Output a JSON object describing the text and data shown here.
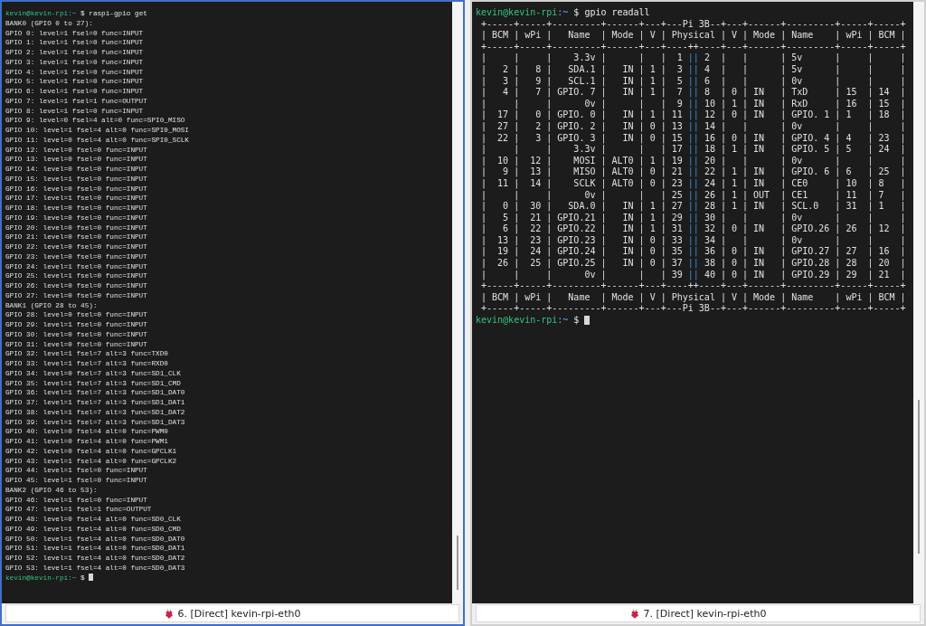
{
  "panes": [
    {
      "focused": true,
      "tab_label": "6. [Direct] kevin-rpi-eth0",
      "lines": [
        {
          "kind": "prompt",
          "user_host": "kevin@kevin-rpi",
          "path": ":~",
          "symbol": "$",
          "command": "raspi-gpio get"
        },
        {
          "kind": "output",
          "text": "BANK0 (GPIO 0 to 27):"
        },
        {
          "kind": "output",
          "text": "GPIO 0: level=1 fsel=0 func=INPUT"
        },
        {
          "kind": "output",
          "text": "GPIO 1: level=1 fsel=0 func=INPUT"
        },
        {
          "kind": "output",
          "text": "GPIO 2: level=1 fsel=0 func=INPUT"
        },
        {
          "kind": "output",
          "text": "GPIO 3: level=1 fsel=0 func=INPUT"
        },
        {
          "kind": "output",
          "text": "GPIO 4: level=1 fsel=0 func=INPUT"
        },
        {
          "kind": "output",
          "text": "GPIO 5: level=1 fsel=0 func=INPUT"
        },
        {
          "kind": "output",
          "text": "GPIO 6: level=1 fsel=0 func=INPUT"
        },
        {
          "kind": "output",
          "text": "GPIO 7: level=1 fsel=1 func=OUTPUT"
        },
        {
          "kind": "output",
          "text": "GPIO 8: level=1 fsel=0 func=INPUT"
        },
        {
          "kind": "output",
          "text": "GPIO 9: level=0 fsel=4 alt=0 func=SPI0_MISO"
        },
        {
          "kind": "output",
          "text": "GPIO 10: level=1 fsel=4 alt=0 func=SPI0_MOSI"
        },
        {
          "kind": "output",
          "text": "GPIO 11: level=0 fsel=4 alt=0 func=SPI0_SCLK"
        },
        {
          "kind": "output",
          "text": "GPIO 12: level=0 fsel=0 func=INPUT"
        },
        {
          "kind": "output",
          "text": "GPIO 13: level=0 fsel=0 func=INPUT"
        },
        {
          "kind": "output",
          "text": "GPIO 14: level=0 fsel=0 func=INPUT"
        },
        {
          "kind": "output",
          "text": "GPIO 15: level=1 fsel=0 func=INPUT"
        },
        {
          "kind": "output",
          "text": "GPIO 16: level=0 fsel=0 func=INPUT"
        },
        {
          "kind": "output",
          "text": "GPIO 17: level=1 fsel=0 func=INPUT"
        },
        {
          "kind": "output",
          "text": "GPIO 18: level=0 fsel=0 func=INPUT"
        },
        {
          "kind": "output",
          "text": "GPIO 19: level=0 fsel=0 func=INPUT"
        },
        {
          "kind": "output",
          "text": "GPIO 20: level=0 fsel=0 func=INPUT"
        },
        {
          "kind": "output",
          "text": "GPIO 21: level=0 fsel=0 func=INPUT"
        },
        {
          "kind": "output",
          "text": "GPIO 22: level=0 fsel=0 func=INPUT"
        },
        {
          "kind": "output",
          "text": "GPIO 23: level=0 fsel=0 func=INPUT"
        },
        {
          "kind": "output",
          "text": "GPIO 24: level=1 fsel=0 func=INPUT"
        },
        {
          "kind": "output",
          "text": "GPIO 25: level=1 fsel=0 func=INPUT"
        },
        {
          "kind": "output",
          "text": "GPIO 26: level=0 fsel=0 func=INPUT"
        },
        {
          "kind": "output",
          "text": "GPIO 27: level=0 fsel=0 func=INPUT"
        },
        {
          "kind": "output",
          "text": "BANK1 (GPIO 28 to 45):"
        },
        {
          "kind": "output",
          "text": "GPIO 28: level=0 fsel=0 func=INPUT"
        },
        {
          "kind": "output",
          "text": "GPIO 29: level=1 fsel=0 func=INPUT"
        },
        {
          "kind": "output",
          "text": "GPIO 30: level=0 fsel=0 func=INPUT"
        },
        {
          "kind": "output",
          "text": "GPIO 31: level=0 fsel=0 func=INPUT"
        },
        {
          "kind": "output",
          "text": "GPIO 32: level=1 fsel=7 alt=3 func=TXD0"
        },
        {
          "kind": "output",
          "text": "GPIO 33: level=1 fsel=7 alt=3 func=RXD0"
        },
        {
          "kind": "output",
          "text": "GPIO 34: level=0 fsel=7 alt=3 func=SD1_CLK"
        },
        {
          "kind": "output",
          "text": "GPIO 35: level=1 fsel=7 alt=3 func=SD1_CMD"
        },
        {
          "kind": "output",
          "text": "GPIO 36: level=1 fsel=7 alt=3 func=SD1_DAT0"
        },
        {
          "kind": "output",
          "text": "GPIO 37: level=1 fsel=7 alt=3 func=SD1_DAT1"
        },
        {
          "kind": "output",
          "text": "GPIO 38: level=1 fsel=7 alt=3 func=SD1_DAT2"
        },
        {
          "kind": "output",
          "text": "GPIO 39: level=1 fsel=7 alt=3 func=SD1_DAT3"
        },
        {
          "kind": "output",
          "text": "GPIO 40: level=0 fsel=4 alt=0 func=PWM0"
        },
        {
          "kind": "output",
          "text": "GPIO 41: level=0 fsel=4 alt=0 func=PWM1"
        },
        {
          "kind": "output",
          "text": "GPIO 42: level=0 fsel=4 alt=0 func=GPCLK1"
        },
        {
          "kind": "output",
          "text": "GPIO 43: level=1 fsel=4 alt=0 func=GPCLK2"
        },
        {
          "kind": "output",
          "text": "GPIO 44: level=1 fsel=0 func=INPUT"
        },
        {
          "kind": "output",
          "text": "GPIO 45: level=1 fsel=0 func=INPUT"
        },
        {
          "kind": "output",
          "text": "BANK2 (GPIO 46 to 53):"
        },
        {
          "kind": "output",
          "text": "GPIO 46: level=1 fsel=0 func=INPUT"
        },
        {
          "kind": "output",
          "text": "GPIO 47: level=1 fsel=1 func=OUTPUT"
        },
        {
          "kind": "output",
          "text": "GPIO 48: level=0 fsel=4 alt=0 func=SD0_CLK"
        },
        {
          "kind": "output",
          "text": "GPIO 49: level=1 fsel=4 alt=0 func=SD0_CMD"
        },
        {
          "kind": "output",
          "text": "GPIO 50: level=1 fsel=4 alt=0 func=SD0_DAT0"
        },
        {
          "kind": "output",
          "text": "GPIO 51: level=1 fsel=4 alt=0 func=SD0_DAT1"
        },
        {
          "kind": "output",
          "text": "GPIO 52: level=1 fsel=4 alt=0 func=SD0_DAT2"
        },
        {
          "kind": "output",
          "text": "GPIO 53: level=1 fsel=4 alt=0 func=SD0_DAT3"
        },
        {
          "kind": "prompt",
          "user_host": "kevin@kevin-rpi",
          "path": ":~",
          "symbol": "$",
          "cursor": true
        }
      ]
    },
    {
      "focused": false,
      "tab_label": "7. [Direct] kevin-rpi-eth0",
      "lines": [
        {
          "kind": "prompt",
          "user_host": "kevin@kevin-rpi",
          "path": ":~",
          "symbol": "$",
          "command": "gpio readall"
        },
        {
          "kind": "output",
          "text": " +-----+-----+---------+------+---+---Pi 3B--+---+------+---------+-----+-----+"
        },
        {
          "kind": "output",
          "text": " | BCM | wPi |   Name  | Mode | V | Physical | V | Mode | Name    | wPi | BCM |"
        },
        {
          "kind": "output",
          "text": " +-----+-----+---------+------+---+----++----+---+------+---------+-----+-----+"
        },
        {
          "kind": "pin_row",
          "left": " |     |     |    3.3v |      |   |  1 ",
          "sep": "||",
          "right": " 2  |   |      | 5v      |     |     |"
        },
        {
          "kind": "pin_row",
          "left": " |   2 |   8 |   SDA.1 |   IN | 1 |  3 ",
          "sep": "||",
          "right": " 4  |   |      | 5v      |     |     |"
        },
        {
          "kind": "pin_row",
          "left": " |   3 |   9 |   SCL.1 |   IN | 1 |  5 ",
          "sep": "||",
          "right": " 6  |   |      | 0v      |     |     |"
        },
        {
          "kind": "pin_row",
          "left": " |   4 |   7 | GPIO. 7 |   IN | 1 |  7 ",
          "sep": "||",
          "right": " 8  | 0 | IN   | TxD     | 15  | 14  |"
        },
        {
          "kind": "pin_row",
          "left": " |     |     |      0v |      |   |  9 ",
          "sep": "||",
          "right": " 10 | 1 | IN   | RxD     | 16  | 15  |"
        },
        {
          "kind": "pin_row",
          "left": " |  17 |   0 | GPIO. 0 |   IN | 1 | 11 ",
          "sep": "||",
          "right": " 12 | 0 | IN   | GPIO. 1 | 1   | 18  |"
        },
        {
          "kind": "pin_row",
          "left": " |  27 |   2 | GPIO. 2 |   IN | 0 | 13 ",
          "sep": "||",
          "right": " 14 |   |      | 0v      |     |     |"
        },
        {
          "kind": "pin_row",
          "left": " |  22 |   3 | GPIO. 3 |   IN | 0 | 15 ",
          "sep": "||",
          "right": " 16 | 0 | IN   | GPIO. 4 | 4   | 23  |"
        },
        {
          "kind": "pin_row",
          "left": " |     |     |    3.3v |      |   | 17 ",
          "sep": "||",
          "right": " 18 | 1 | IN   | GPIO. 5 | 5   | 24  |"
        },
        {
          "kind": "pin_row",
          "left": " |  10 |  12 |    MOSI | ALT0 | 1 | 19 ",
          "sep": "||",
          "right": " 20 |   |      | 0v      |     |     |"
        },
        {
          "kind": "pin_row",
          "left": " |   9 |  13 |    MISO | ALT0 | 0 | 21 ",
          "sep": "||",
          "right": " 22 | 1 | IN   | GPIO. 6 | 6   | 25  |"
        },
        {
          "kind": "pin_row",
          "left": " |  11 |  14 |    SCLK | ALT0 | 0 | 23 ",
          "sep": "||",
          "right": " 24 | 1 | IN   | CE0     | 10  | 8   |"
        },
        {
          "kind": "pin_row",
          "left": " |     |     |      0v |      |   | 25 ",
          "sep": "||",
          "right": " 26 | 1 | OUT  | CE1     | 11  | 7   |"
        },
        {
          "kind": "pin_row",
          "left": " |   0 |  30 |   SDA.0 |   IN | 1 | 27 ",
          "sep": "||",
          "right": " 28 | 1 | IN   | SCL.0   | 31  | 1   |"
        },
        {
          "kind": "pin_row",
          "left": " |   5 |  21 | GPIO.21 |   IN | 1 | 29 ",
          "sep": "||",
          "right": " 30 |   |      | 0v      |     |     |"
        },
        {
          "kind": "pin_row",
          "left": " |   6 |  22 | GPIO.22 |   IN | 1 | 31 ",
          "sep": "||",
          "right": " 32 | 0 | IN   | GPIO.26 | 26  | 12  |"
        },
        {
          "kind": "pin_row",
          "left": " |  13 |  23 | GPIO.23 |   IN | 0 | 33 ",
          "sep": "||",
          "right": " 34 |   |      | 0v      |     |     |"
        },
        {
          "kind": "pin_row",
          "left": " |  19 |  24 | GPIO.24 |   IN | 0 | 35 ",
          "sep": "||",
          "right": " 36 | 0 | IN   | GPIO.27 | 27  | 16  |"
        },
        {
          "kind": "pin_row",
          "left": " |  26 |  25 | GPIO.25 |   IN | 0 | 37 ",
          "sep": "||",
          "right": " 38 | 0 | IN   | GPIO.28 | 28  | 20  |"
        },
        {
          "kind": "pin_row",
          "left": " |     |     |      0v |      |   | 39 ",
          "sep": "||",
          "right": " 40 | 0 | IN   | GPIO.29 | 29  | 21  |"
        },
        {
          "kind": "output",
          "text": " +-----+-----+---------+------+---+----++----+---+------+---------+-----+-----+"
        },
        {
          "kind": "output",
          "text": " | BCM | wPi |   Name  | Mode | V | Physical | V | Mode | Name    | wPi | BCM |"
        },
        {
          "kind": "output",
          "text": " +-----+-----+---------+------+---+---Pi 3B--+---+------+---------+-----+-----+"
        },
        {
          "kind": "prompt",
          "user_host": "kevin@kevin-rpi",
          "path": ":~",
          "symbol": "$",
          "cursor": true
        }
      ]
    }
  ]
}
